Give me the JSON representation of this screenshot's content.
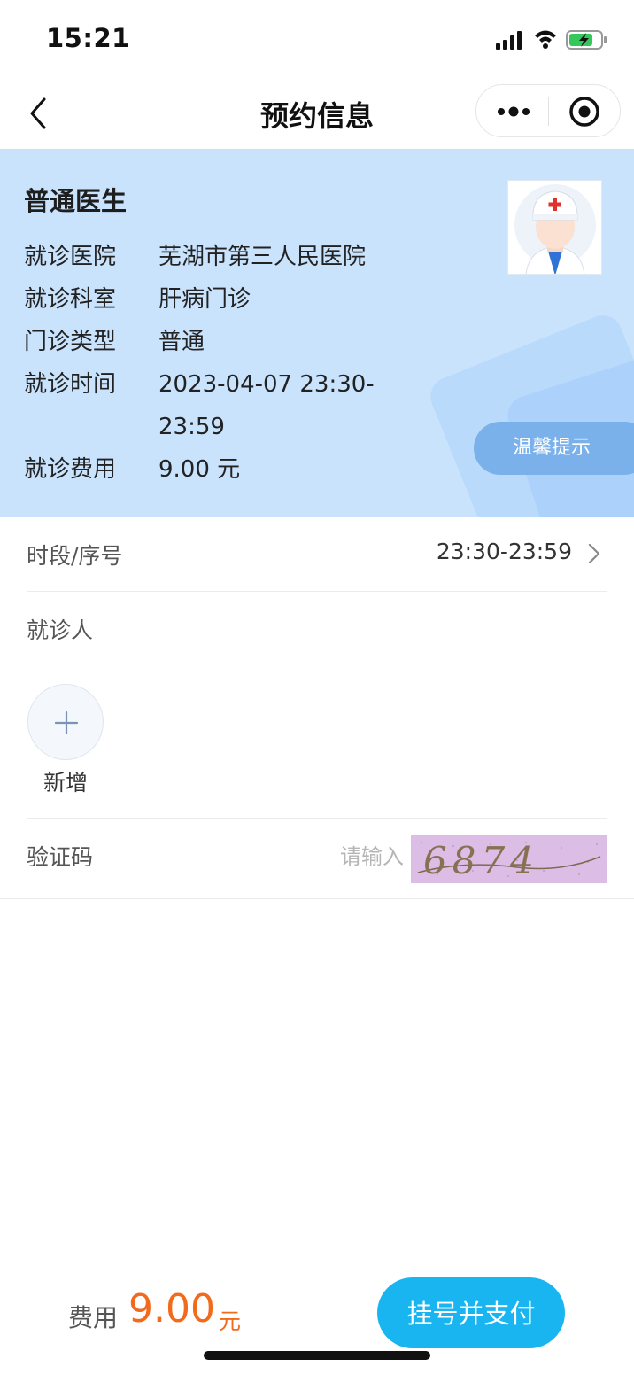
{
  "status_bar": {
    "time": "15:21"
  },
  "nav": {
    "title": "预约信息"
  },
  "card": {
    "doctor_title": "普通医生",
    "rows": [
      {
        "label": "就诊医院",
        "value": "芜湖市第三人民医院"
      },
      {
        "label": "就诊科室",
        "value": "肝病门诊"
      },
      {
        "label": "门诊类型",
        "value": "普通"
      },
      {
        "label": "就诊时间",
        "value": "2023-04-07 23:30-",
        "value_cont": "23:59"
      },
      {
        "label": "就诊费用",
        "value": "9.00 元"
      }
    ],
    "tip_label": "温馨提示"
  },
  "form": {
    "slot_label": "时段/序号",
    "slot_value": "23:30-23:59",
    "patient_label": "就诊人",
    "add_label": "新增",
    "captcha_label": "验证码",
    "captcha_placeholder": "请输入",
    "captcha_text": "6874"
  },
  "footer": {
    "fee_label": "费用",
    "fee_amount": "9.00",
    "fee_unit": "元",
    "pay_label": "挂号并支付"
  },
  "colors": {
    "accent": "#18b5f0",
    "price": "#f26a1b",
    "card_bg": "#c9e3fd"
  }
}
